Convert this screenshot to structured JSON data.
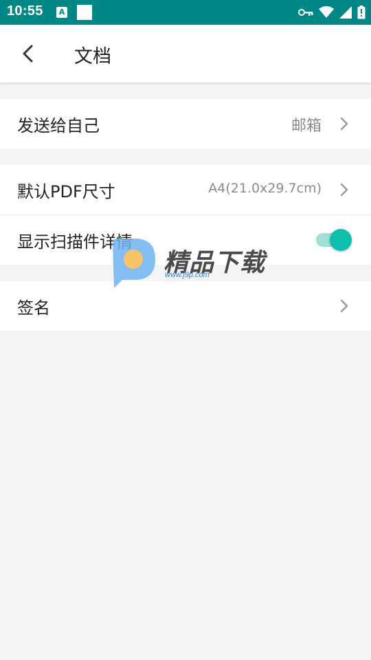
{
  "status_bar": {
    "time": "10:55",
    "notif_letter": "A"
  },
  "app_bar": {
    "title": "文档"
  },
  "rows": {
    "send_to_self": {
      "label": "发送给自己",
      "value": "邮箱"
    },
    "pdf_size": {
      "label": "默认PDF尺寸",
      "value": "A4(21.0x29.7cm)"
    },
    "show_scan_details": {
      "label": "显示扫描件详情",
      "toggle_on": true
    },
    "signature": {
      "label": "签名"
    }
  },
  "watermark": {
    "text": "精品下载",
    "url": "www.j9p.com"
  },
  "colors": {
    "status_bar": "#018786",
    "accent": "#0fbfad",
    "accent_track": "#9fe0d8",
    "background": "#f4f4f4"
  }
}
